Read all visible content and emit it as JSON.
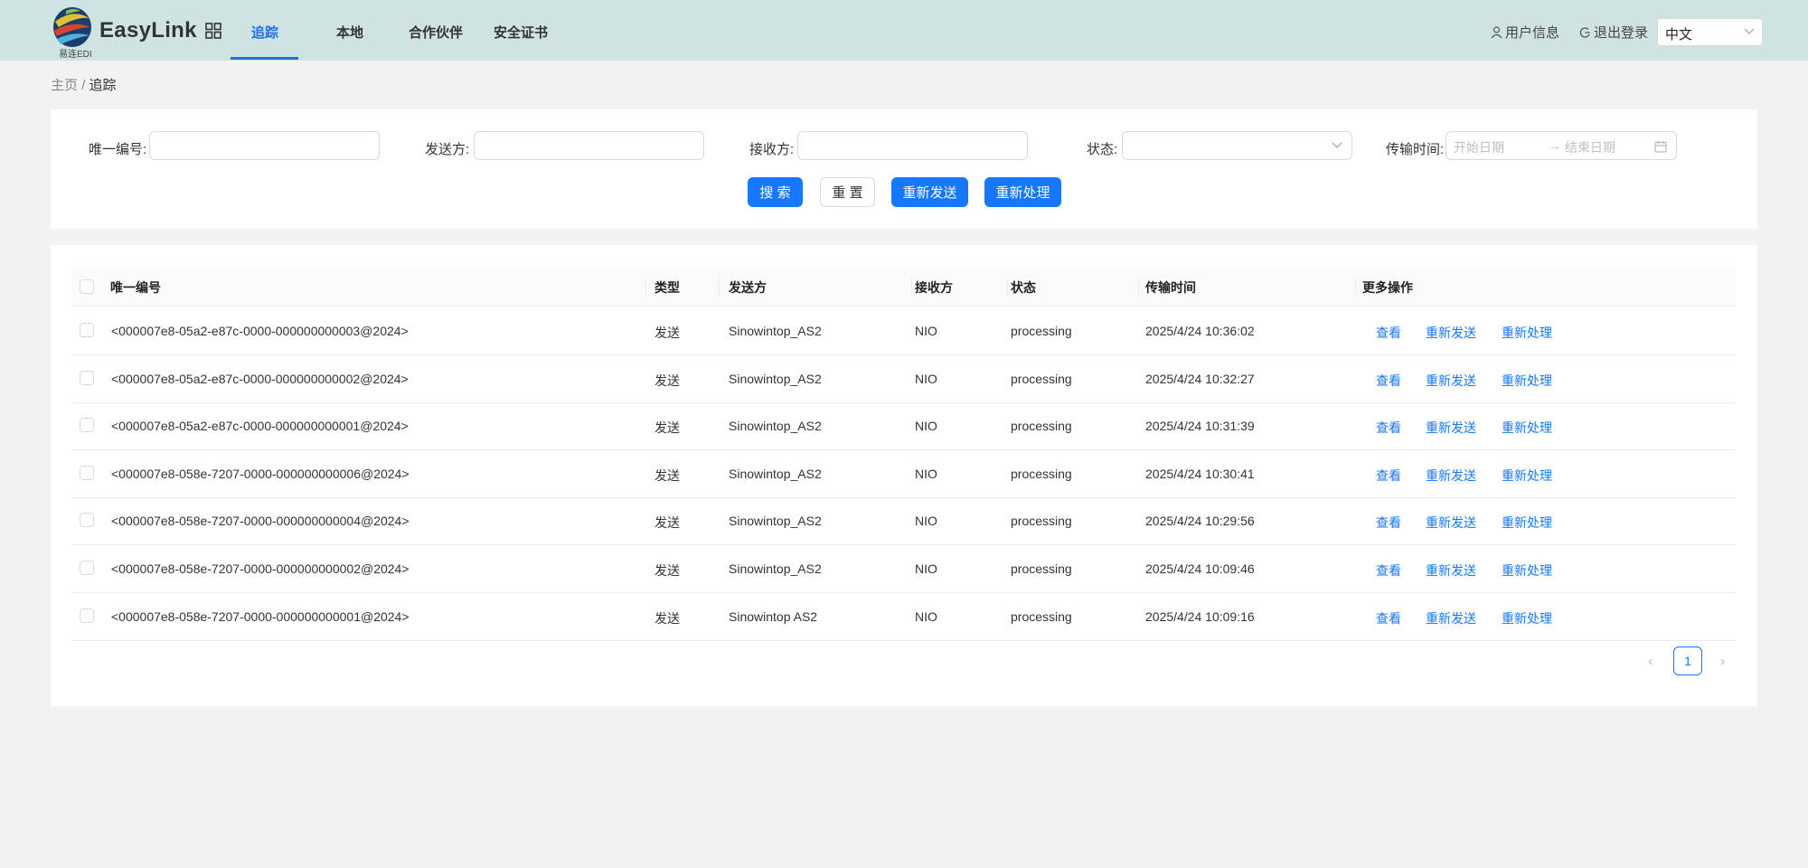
{
  "header": {
    "logo_caption": "易连EDI",
    "brand": "EasyLink",
    "nav": [
      "追踪",
      "本地",
      "合作伙伴",
      "安全证书"
    ],
    "active_nav": "追踪",
    "user_info": "用户信息",
    "logout": "退出登录",
    "language": "中文"
  },
  "breadcrumb": {
    "home": "主页",
    "separator": "/",
    "current": "追踪"
  },
  "filter": {
    "id_label": "唯一编号",
    "sender_label": "发送方",
    "receiver_label": "接收方",
    "status_label": "状态",
    "time_label": "传输时间",
    "colon": ":",
    "start_placeholder": "开始日期",
    "end_placeholder": "结束日期",
    "search_button": "搜 索",
    "reset_button": "重 置",
    "resend_button": "重新发送",
    "reprocess_button": "重新处理"
  },
  "table": {
    "columns": [
      "唯一编号",
      "类型",
      "发送方",
      "接收方",
      "状态",
      "传输时间",
      "更多操作"
    ],
    "actions": [
      "查看",
      "重新发送",
      "重新处理"
    ],
    "rows": [
      {
        "id": "<000007e8-05a2-e87c-0000-000000000003@2024>",
        "type": "发送",
        "sender": "Sinowintop_AS2",
        "receiver": "NIO",
        "status": "processing",
        "time": "2025/4/24 10:36:02"
      },
      {
        "id": "<000007e8-05a2-e87c-0000-000000000002@2024>",
        "type": "发送",
        "sender": "Sinowintop_AS2",
        "receiver": "NIO",
        "status": "processing",
        "time": "2025/4/24 10:32:27"
      },
      {
        "id": "<000007e8-05a2-e87c-0000-000000000001@2024>",
        "type": "发送",
        "sender": "Sinowintop_AS2",
        "receiver": "NIO",
        "status": "processing",
        "time": "2025/4/24 10:31:39"
      },
      {
        "id": "<000007e8-058e-7207-0000-000000000006@2024>",
        "type": "发送",
        "sender": "Sinowintop_AS2",
        "receiver": "NIO",
        "status": "processing",
        "time": "2025/4/24 10:30:41"
      },
      {
        "id": "<000007e8-058e-7207-0000-000000000004@2024>",
        "type": "发送",
        "sender": "Sinowintop_AS2",
        "receiver": "NIO",
        "status": "processing",
        "time": "2025/4/24 10:29:56"
      },
      {
        "id": "<000007e8-058e-7207-0000-000000000002@2024>",
        "type": "发送",
        "sender": "Sinowintop_AS2",
        "receiver": "NIO",
        "status": "processing",
        "time": "2025/4/24 10:09:46"
      },
      {
        "id": "<000007e8-058e-7207-0000-000000000001@2024>",
        "type": "发送",
        "sender": "Sinowintop AS2",
        "receiver": "NIO",
        "status": "processing",
        "time": "2025/4/24 10:09:16"
      }
    ]
  },
  "pagination": {
    "current_page": "1",
    "prev": "‹",
    "next": "›"
  },
  "colors": {
    "header_bg": "#cfe4e2",
    "primary": "#1677ff",
    "page_bg": "#f2f2f2"
  }
}
